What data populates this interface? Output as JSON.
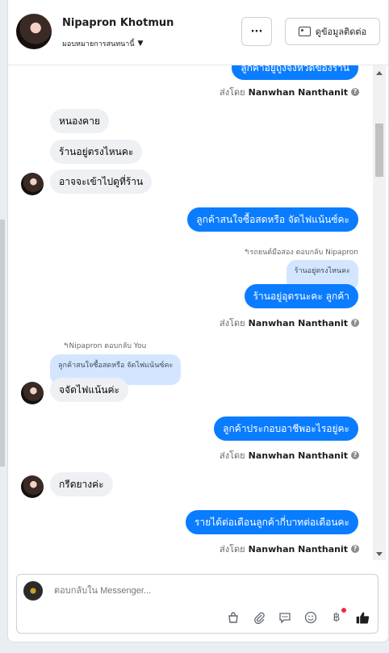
{
  "header": {
    "name": "Nipapron Khotmun",
    "assign_label": "มอบหมายการสนทนานี้",
    "more_label": "···",
    "info_button": "ดูข้อมูลติดต่อ"
  },
  "messages": {
    "partial_top": "ลูกค้าอยู่ถูงจังหวัดของร้าน",
    "sent_by_prefix": "ส่งโดย",
    "agent_name": "Nanwhan Nanthanit",
    "help_glyph": "?",
    "in1": "หนองคาย",
    "in2": "ร้านอยู่ตรงไหนคะ",
    "in3": "อาจจะเข้าไปดูที่ร้าน",
    "out1": "ลูกค้าสนใจซื้อสดหรือ จัดไฟแน้นซ์คะ",
    "reply_note_out": "↰รถยนต์มือสอง ตอบกลับ Nipapron",
    "quote_out": "ร้านอยู่ตรงไหนคะ",
    "out2": "ร้านอยู่อุดรนะคะ ลูกค้า",
    "reply_note_in": "↰Nipapron ตอบกลับ You",
    "quote_in": "ลูกค้าสนใจซื้อสดหรือ จัดไฟแน้นซ์คะ",
    "in4": "จจัดไฟแน้นค่ะ",
    "out3": "ลูกค้าประกอบอาชีพอะไรอยู่คะ",
    "in5": "กรีดยางค่ะ",
    "out4": "รายได้ต่อเดือนลูกค้ากี่บาทต่อเดือนคะ"
  },
  "composer": {
    "placeholder": "ตอบกลับใน Messenger...",
    "tools": [
      "bag-icon",
      "paperclip-icon",
      "chat-icon",
      "emoji-icon",
      "baht-icon",
      "thumbs-up-icon"
    ],
    "baht_glyph": "฿",
    "notification_color": "#f02849"
  },
  "colors": {
    "accent": "#0a7cff",
    "incoming_bubble": "#eef0f3",
    "quote_bubble": "#d4e6ff"
  }
}
